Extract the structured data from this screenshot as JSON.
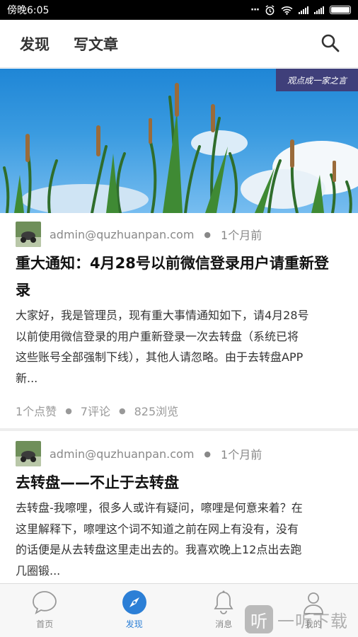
{
  "status_bar": {
    "time": "傍晚6:05",
    "dots": "···"
  },
  "header": {
    "tabs": [
      "发现",
      "写文章"
    ]
  },
  "banner": {
    "caption": "观点成一家之言"
  },
  "posts": [
    {
      "author": "admin@quzhuanpan.com",
      "time": "1个月前",
      "title_line1": "重大通知：4月28号以前微信登录用户请重新登",
      "title_line2": "录",
      "body": [
        "大家好，我是管理员，现有重大事情通知如下，请4月28号",
        "以前使用微信登录的用户重新登录一次去转盘（系统已将",
        "这些账号全部强制下线），其他人请忽略。由于去转盘APP",
        "新..."
      ],
      "likes": "1个点赞",
      "comments": "7评论",
      "views": "825浏览"
    },
    {
      "author": "admin@quzhuanpan.com",
      "time": "1个月前",
      "title_line1": "去转盘——不止于去转盘",
      "body": [
        "去转盘-我嚓哩，很多人或许有疑问，嚓哩是何意来着？在",
        "这里解释下，嚓哩这个词不知道之前在网上有没有，没有",
        "的话便是从去转盘这里走出去的。我喜欢晚上12点出去跑",
        "几圈锻..."
      ]
    }
  ],
  "bottom_nav": [
    {
      "label": "首页",
      "icon": "chat-bubble-icon"
    },
    {
      "label": "发现",
      "icon": "compass-icon"
    },
    {
      "label": "消息",
      "icon": "bell-icon"
    },
    {
      "label": "我的",
      "icon": "user-icon"
    }
  ],
  "watermark": {
    "logo": "听",
    "text": "一听下载"
  },
  "colors": {
    "accent": "#2c7fd6",
    "header_bg": "#ffffff",
    "status_bar": "#000000"
  }
}
